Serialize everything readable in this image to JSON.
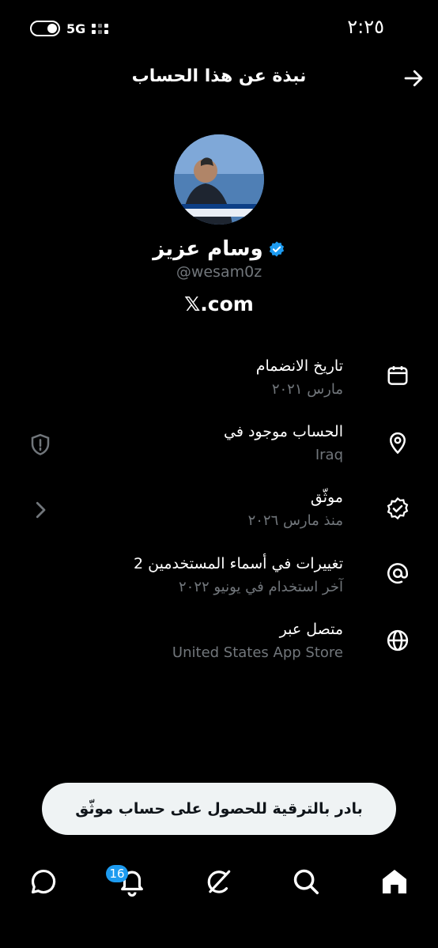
{
  "status": {
    "time": "٢:٢٥",
    "network": "5G"
  },
  "header": {
    "title": "نبذة عن هذا الحساب"
  },
  "profile": {
    "name": "وسام عزيز",
    "handle": "@wesam0z",
    "site": "𝕏.com"
  },
  "rows": [
    {
      "title": "تاريخ الانضمام",
      "subtitle": "مارس ٢٠٢١"
    },
    {
      "title": "الحساب موجود في",
      "subtitle": "Iraq"
    },
    {
      "title": "موثّق",
      "subtitle": "منذ مارس ٢٠٢٦"
    },
    {
      "title": "2 تغييرات في أسماء المستخدمين",
      "subtitle": "آخر استخدام في يونيو ٢٠٢٢"
    },
    {
      "title": "متصل عبر",
      "subtitle": "United States App Store"
    }
  ],
  "upgrade": {
    "label": "بادر بالترقية للحصول على حساب موثّق"
  },
  "nav": {
    "notifications_count": "16"
  },
  "colors": {
    "accent": "#1d9bf0",
    "muted": "#71767b",
    "background": "#000000"
  }
}
